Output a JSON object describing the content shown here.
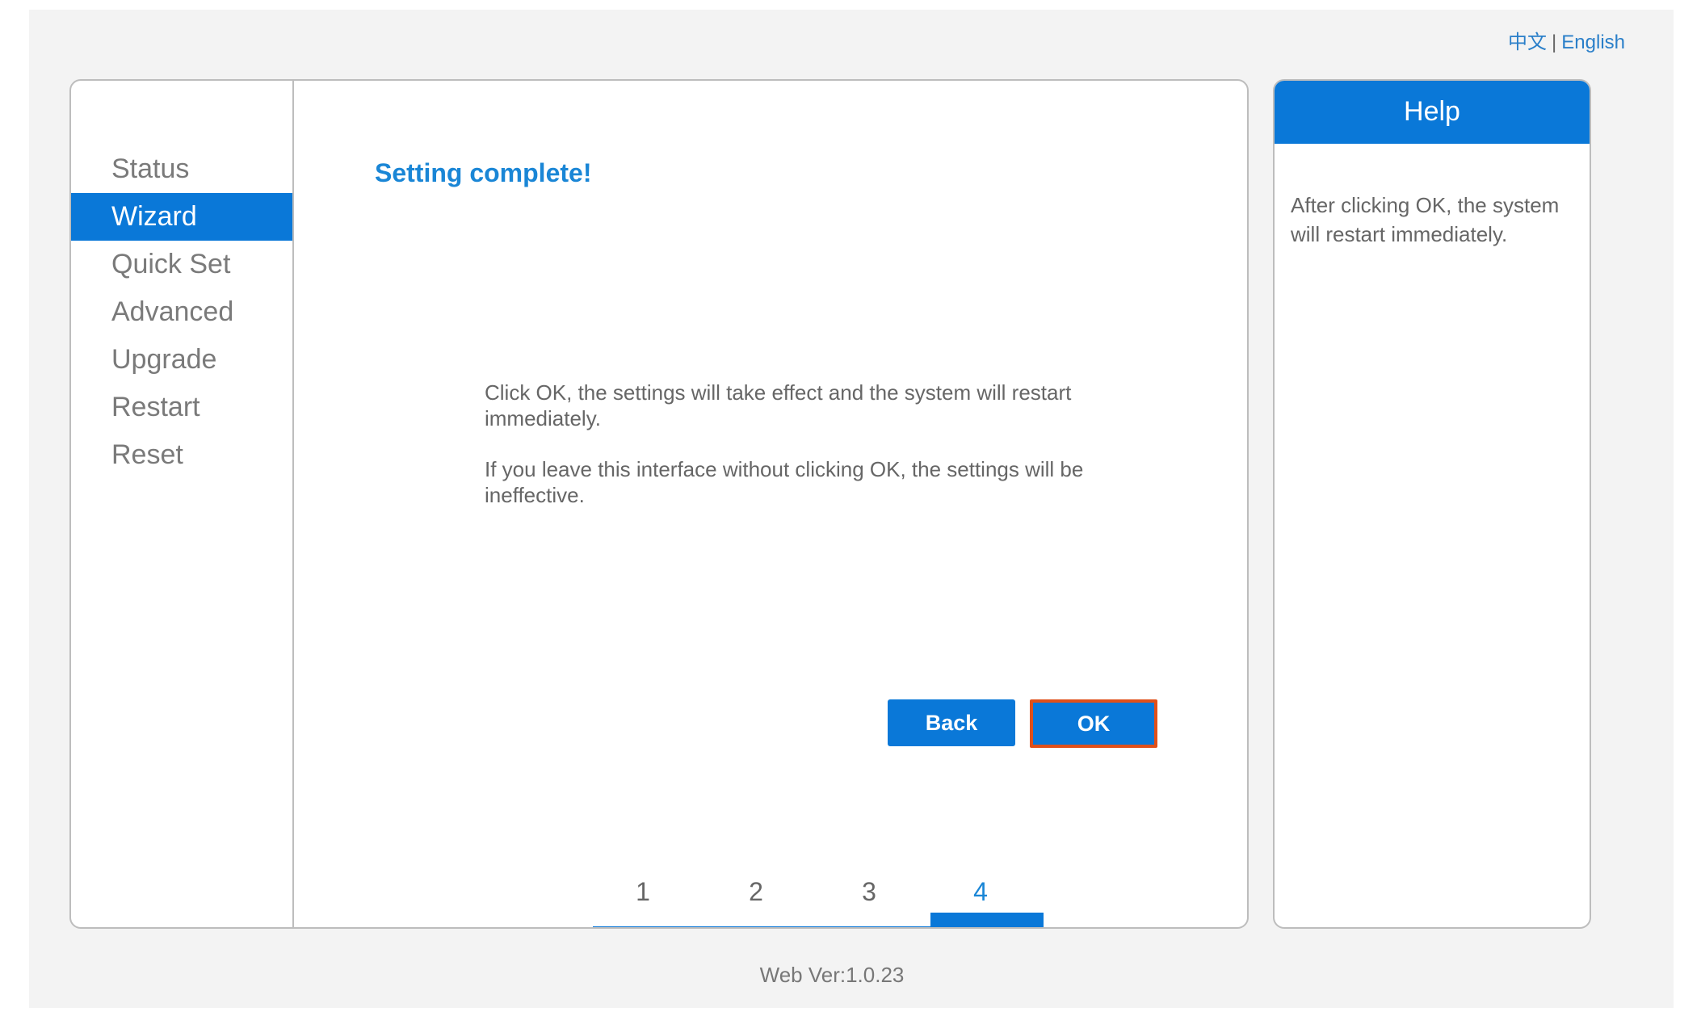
{
  "language": {
    "chinese": "中文",
    "separator": "|",
    "english": "English"
  },
  "nav": {
    "items": [
      {
        "label": "Status"
      },
      {
        "label": "Wizard",
        "active": true
      },
      {
        "label": "Quick Set"
      },
      {
        "label": "Advanced"
      },
      {
        "label": "Upgrade"
      },
      {
        "label": "Restart"
      },
      {
        "label": "Reset"
      }
    ]
  },
  "main": {
    "title": "Setting complete!",
    "message1": "Click OK, the settings will take effect and the system will restart immediately.",
    "message2": "If you leave this interface without clicking OK, the settings will be ineffective.",
    "back_label": "Back",
    "ok_label": "OK",
    "steps": [
      "1",
      "2",
      "3",
      "4"
    ],
    "current_step": 4
  },
  "help": {
    "title": "Help",
    "text": "After clicking OK, the system will restart immediately."
  },
  "footer": {
    "version": "Web Ver:1.0.23"
  },
  "colors": {
    "accent": "#0a78d8",
    "ok_outline": "#e0501a",
    "title_blue": "#1a86d6"
  }
}
